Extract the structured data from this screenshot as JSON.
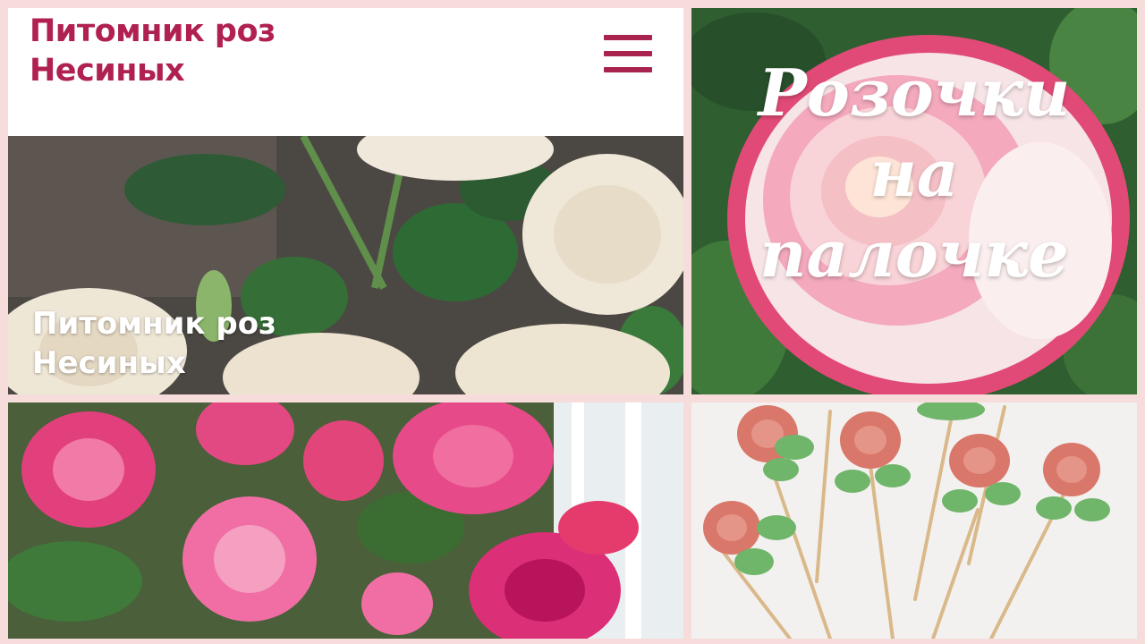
{
  "site": {
    "title_line1": "Питомник роз",
    "title_line2": "Несиных",
    "menu_icon": "hamburger-menu-icon",
    "brand_color": "#b02152"
  },
  "hero": {
    "title_line1": "Питомник роз",
    "title_line2": "Несиных"
  },
  "caption": {
    "line1": "Розочки",
    "line2": "на",
    "line3": "палочке"
  },
  "colors": {
    "background": "#f7dcdc",
    "rose_pink": "#e2457a",
    "cream_rose": "#f1eadb",
    "leaf_green": "#3f7a3a",
    "lollipop_rose": "#d9776a",
    "lollipop_leaf": "#6fb56a"
  }
}
